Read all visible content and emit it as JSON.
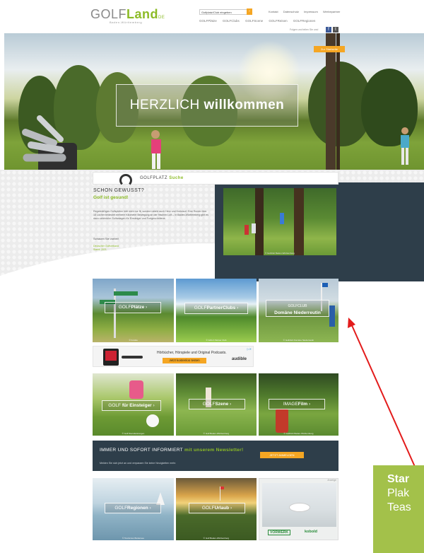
{
  "header": {
    "logo_main": "GOLF",
    "logo_accent": "Land",
    "logo_suffix": "DE",
    "logo_sub": "Baden-Württemberg",
    "search_placeholder": "Golfplatz/Club eingeben",
    "top_links": [
      "Kontakt",
      "Datenschutz",
      "Impressum",
      "Werbepartner"
    ],
    "main_nav": [
      "GOLFPlätze",
      "GOLFClubs",
      "GOLFScene",
      "GOLFReisen",
      "GOLFRegionen"
    ],
    "social_text": "Folgen und teilen Sie uns!",
    "fb": "f",
    "tw": "t"
  },
  "hero": {
    "title_light": "HERZLICH",
    "title_bold": "willkommen",
    "cta": "Zur Startseite"
  },
  "golfsearch": {
    "prefix": "GOLFPLATZ",
    "accent": "Suche"
  },
  "didyouknow": {
    "title": "SCHON GEWUSST?",
    "subtitle": "Golf ist gesund!",
    "text": "Regelmäßiges Golfspielen hält nicht nur fit, sondern stärkt auch Herz und Kreislauf. Eine Runde über 18 Löcher bedeutet mehrere Kilometer Bewegung an der frischen Luft – in Baden-Württemberg gibt es dazu zahlreiche Golfanlagen für Einsteiger und Fortgeschrittene.",
    "more": "Schauen Sie vorbei!",
    "source": "Deutscher Golfverband\nStand: 2021",
    "photo_caption": "© Golfclub Baden-Württemberg"
  },
  "tiles_row1": [
    {
      "prefix": "GOLF",
      "bold": "Plätze",
      "caption": "© Fotolia"
    },
    {
      "prefix": "GOLF",
      "bold": "PartnerClubs",
      "caption": "© GOLF Partner Club"
    },
    {
      "prefix": "GOLFCLUB",
      "bold": "Domäne Niederreutin",
      "caption": "© Golfclub Domäne Niederreutin"
    }
  ],
  "ad": {
    "text": "Hörbücher, Hörspiele und Original Podcasts.",
    "button": "Jetzt kostenlos testen",
    "brand": "audible",
    "adchoice": "▷✕"
  },
  "tiles_row2": [
    {
      "prefix": "GOLF",
      "bold": "für Einsteiger",
      "caption": "© Golf Dienstleistungen"
    },
    {
      "prefix": "GOLF",
      "bold": "Szene",
      "caption": "© Golf Baden-Württemberg"
    },
    {
      "prefix": "IMAGE",
      "bold": "Film",
      "caption": "© Golfclub Baden-Württemberg"
    }
  ],
  "newsletter": {
    "title": "IMMER UND SOFORT INFORMIERT",
    "title_accent": "mit unserem Newsletter!",
    "sub": "Melden Sie sich jetzt an und verpassen Sie keine Neuigkeiten mehr.",
    "button": "JETZT ANMELDEN"
  },
  "tiles_row3": [
    {
      "prefix": "GOLF",
      "bold": "Regionen",
      "caption": "© Tourismus Bodensee"
    },
    {
      "prefix": "GOLF",
      "bold": "Urlaub",
      "caption": "© Golf Baden-Württemberg"
    }
  ],
  "ad2": {
    "tag": "Anzeige",
    "brand1": "VORWERK",
    "brand2": "kobold"
  },
  "callout": {
    "line1": "Star",
    "line2": "Plak",
    "line3": "Teas"
  },
  "colors": {
    "accent": "#8cbb26",
    "orange": "#f5a623",
    "dark": "#2e3e4a",
    "callout": "#a3c14a",
    "arrow": "#e31b1b"
  }
}
